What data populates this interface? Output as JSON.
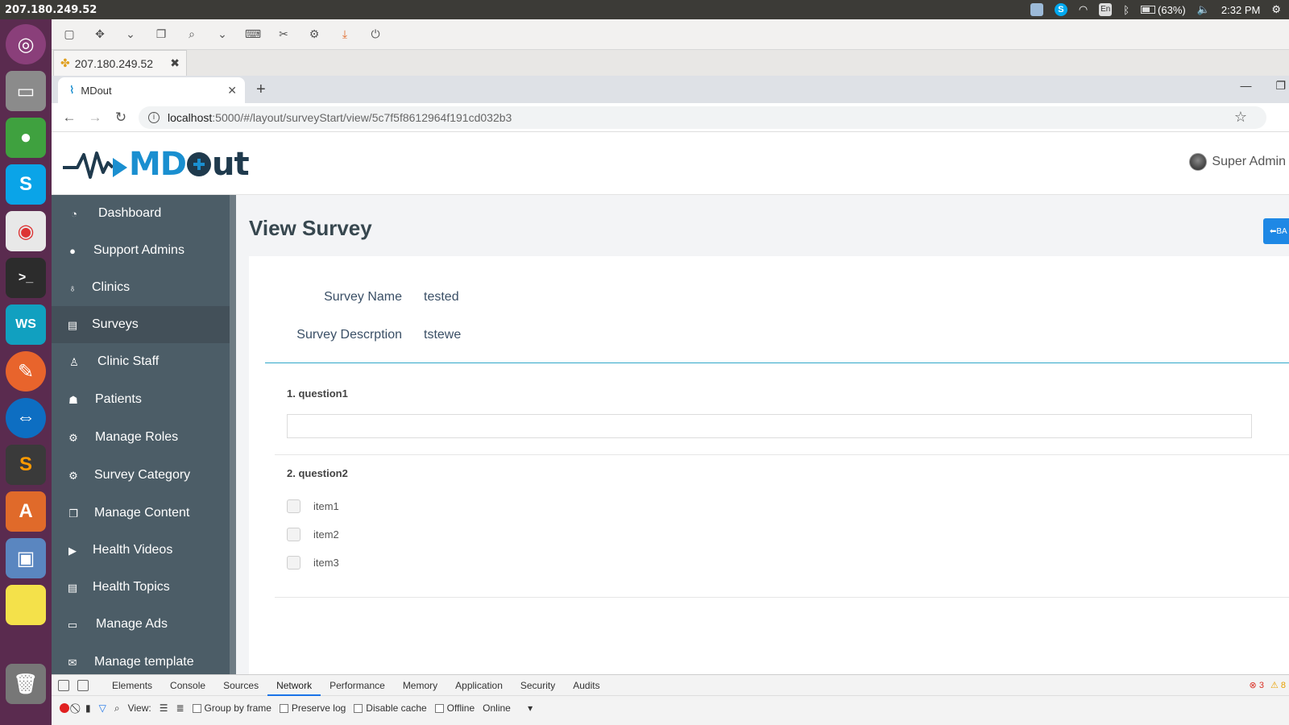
{
  "os": {
    "title": "207.180.249.52",
    "battery": "(63%)",
    "time": "2:32 PM",
    "lang": "En"
  },
  "launcher": {
    "items": [
      "ubuntu-dash",
      "files",
      "remote-app",
      "skype",
      "chrome",
      "terminal",
      "webstorm",
      "postman",
      "teamviewer",
      "sublime-text",
      "software-center",
      "remote-desktop",
      "sticky-notes",
      "trash"
    ]
  },
  "remote_viewer": {
    "tab_label": "207.180.249.52"
  },
  "browser": {
    "tab_title": "MDout",
    "url_host": "localhost",
    "url_rest": ":5000/#/layout/surveyStart/view/5c7f5f8612964f191cd032b3"
  },
  "app": {
    "logo_text_main": "MD",
    "logo_text_tail": "ut",
    "user_name": "Super Admin",
    "page_title": "View Survey",
    "back_label": "BA",
    "sidebar": [
      {
        "label": "Dashboard",
        "icon": "dashboard-icon"
      },
      {
        "label": "Support Admins",
        "icon": "user-circle-icon"
      },
      {
        "label": "Clinics",
        "icon": "stethoscope-icon"
      },
      {
        "label": "Surveys",
        "icon": "document-icon"
      },
      {
        "label": "Clinic Staff",
        "icon": "user-md-icon"
      },
      {
        "label": "Patients",
        "icon": "users-icon"
      },
      {
        "label": "Manage Roles",
        "icon": "cogs-icon"
      },
      {
        "label": "Survey Category",
        "icon": "cogs-icon"
      },
      {
        "label": "Manage Content",
        "icon": "copy-icon"
      },
      {
        "label": "Health Videos",
        "icon": "play-circle-icon"
      },
      {
        "label": "Health Topics",
        "icon": "document-icon"
      },
      {
        "label": "Manage Ads",
        "icon": "monitor-icon"
      },
      {
        "label": "Manage template",
        "icon": "envelope-icon"
      }
    ],
    "survey": {
      "name_label": "Survey Name",
      "name_value": "tested",
      "desc_label": "Survey Descrption",
      "desc_value": "tstewe",
      "questions": [
        {
          "title": "1. question1",
          "type": "text",
          "value": ""
        },
        {
          "title": "2. question2",
          "type": "checkbox",
          "options": [
            "item1",
            "item2",
            "item3"
          ]
        }
      ]
    }
  },
  "devtools": {
    "tabs": [
      "Elements",
      "Console",
      "Sources",
      "Network",
      "Performance",
      "Memory",
      "Application",
      "Security",
      "Audits"
    ],
    "active_tab": "Network",
    "errors": "3",
    "warnings": "8",
    "view_label": "View:",
    "group_by_frame": "Group by frame",
    "preserve_log": "Preserve log",
    "disable_cache": "Disable cache",
    "offline": "Offline",
    "throttle": "Online"
  },
  "colors": {
    "launcher": "#5a2b4f",
    "sidebar": "#4c5d67",
    "accent": "#1e88e5",
    "divider": "#30a7c9",
    "logo_blue": "#1a8fd0"
  }
}
